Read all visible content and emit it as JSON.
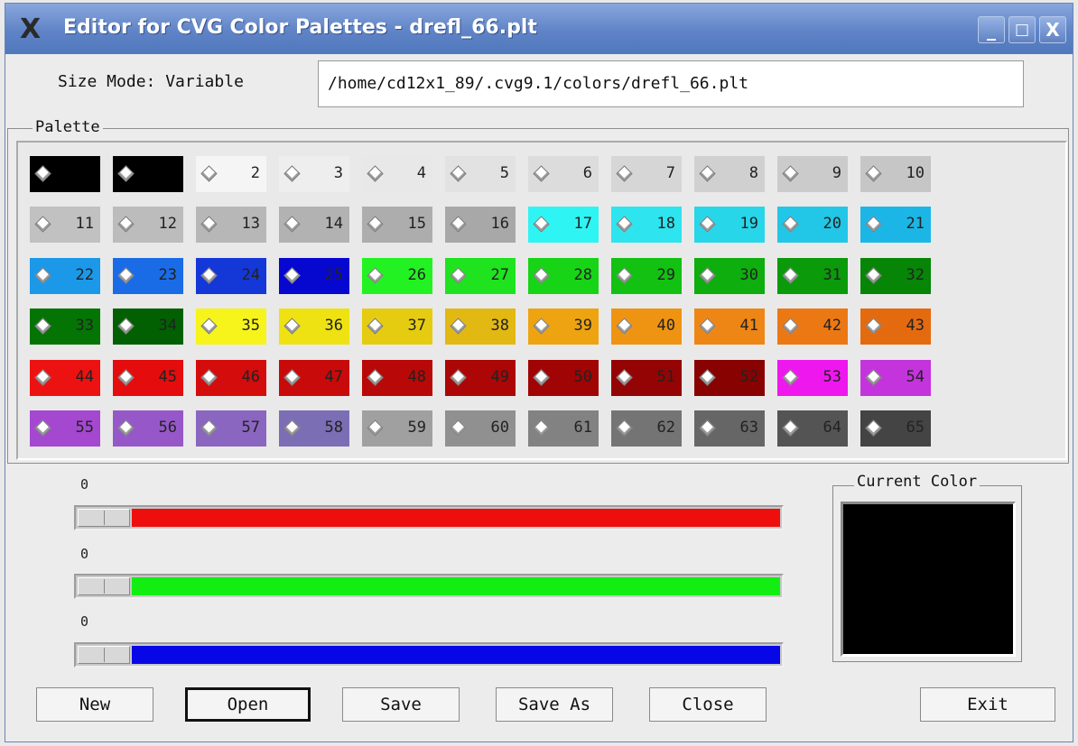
{
  "window": {
    "title": "Editor for CVG Color Palettes - drefl_66.plt",
    "app_icon": "X",
    "controls": {
      "minimize": "_",
      "maximize": "□",
      "close": "X"
    }
  },
  "header": {
    "size_mode": "Size Mode: Variable",
    "file_path": "/home/cd12x1_89/.cvg9.1/colors/drefl_66.plt"
  },
  "palette": {
    "label": "Palette",
    "swatches": [
      {
        "num": "",
        "color": "#000000"
      },
      {
        "num": "",
        "color": "#000000"
      },
      {
        "num": "2",
        "color": "#f5f5f5"
      },
      {
        "num": "3",
        "color": "#eeeeee"
      },
      {
        "num": "4",
        "color": "#e8e8e8"
      },
      {
        "num": "5",
        "color": "#e2e2e2"
      },
      {
        "num": "6",
        "color": "#dcdcdc"
      },
      {
        "num": "7",
        "color": "#d6d6d6"
      },
      {
        "num": "8",
        "color": "#d0d0d0"
      },
      {
        "num": "9",
        "color": "#cbcbcb"
      },
      {
        "num": "10",
        "color": "#c6c6c6"
      },
      {
        "num": "11",
        "color": "#c1c1c1"
      },
      {
        "num": "12",
        "color": "#bcbcbc"
      },
      {
        "num": "13",
        "color": "#b7b7b7"
      },
      {
        "num": "14",
        "color": "#b2b2b2"
      },
      {
        "num": "15",
        "color": "#adadad"
      },
      {
        "num": "16",
        "color": "#a8a8a8"
      },
      {
        "num": "17",
        "color": "#2ff4f4"
      },
      {
        "num": "18",
        "color": "#2ee4ee"
      },
      {
        "num": "19",
        "color": "#28d6ea"
      },
      {
        "num": "20",
        "color": "#22c6e6"
      },
      {
        "num": "21",
        "color": "#1cb6e6"
      },
      {
        "num": "22",
        "color": "#1c98e8"
      },
      {
        "num": "23",
        "color": "#1a6be6"
      },
      {
        "num": "24",
        "color": "#1437d8"
      },
      {
        "num": "25",
        "color": "#0608d0"
      },
      {
        "num": "26",
        "color": "#22f222"
      },
      {
        "num": "27",
        "color": "#1ee31e"
      },
      {
        "num": "28",
        "color": "#17d417"
      },
      {
        "num": "29",
        "color": "#12c112"
      },
      {
        "num": "30",
        "color": "#0eae0e"
      },
      {
        "num": "31",
        "color": "#0a9a0a"
      },
      {
        "num": "32",
        "color": "#078507"
      },
      {
        "num": "33",
        "color": "#047404"
      },
      {
        "num": "34",
        "color": "#026002"
      },
      {
        "num": "35",
        "color": "#f6f41a"
      },
      {
        "num": "36",
        "color": "#eee212"
      },
      {
        "num": "37",
        "color": "#e6cc10"
      },
      {
        "num": "38",
        "color": "#e2b812"
      },
      {
        "num": "39",
        "color": "#eea410"
      },
      {
        "num": "40",
        "color": "#ee9412"
      },
      {
        "num": "41",
        "color": "#ee8616"
      },
      {
        "num": "42",
        "color": "#ec7814"
      },
      {
        "num": "43",
        "color": "#e46a10"
      },
      {
        "num": "44",
        "color": "#ec1212"
      },
      {
        "num": "45",
        "color": "#e40c0c"
      },
      {
        "num": "46",
        "color": "#d40c0c"
      },
      {
        "num": "47",
        "color": "#c80a0a"
      },
      {
        "num": "48",
        "color": "#b80808"
      },
      {
        "num": "49",
        "color": "#ac0606"
      },
      {
        "num": "50",
        "color": "#a00404"
      },
      {
        "num": "51",
        "color": "#940404"
      },
      {
        "num": "52",
        "color": "#880202"
      },
      {
        "num": "53",
        "color": "#ee18ee"
      },
      {
        "num": "54",
        "color": "#c434dc"
      },
      {
        "num": "55",
        "color": "#a448d0"
      },
      {
        "num": "56",
        "color": "#9658c8"
      },
      {
        "num": "57",
        "color": "#8a66c0"
      },
      {
        "num": "58",
        "color": "#7c6eb4"
      },
      {
        "num": "59",
        "color": "#a0a0a0"
      },
      {
        "num": "60",
        "color": "#909090"
      },
      {
        "num": "61",
        "color": "#828282"
      },
      {
        "num": "62",
        "color": "#747474"
      },
      {
        "num": "63",
        "color": "#666666"
      },
      {
        "num": "64",
        "color": "#545454"
      },
      {
        "num": "65",
        "color": "#444444"
      }
    ]
  },
  "sliders": [
    {
      "name": "red",
      "value": "0",
      "level": 0,
      "color": "#ee0e0e"
    },
    {
      "name": "green",
      "value": "0",
      "level": 0,
      "color": "#12ee12"
    },
    {
      "name": "blue",
      "value": "0",
      "level": 0,
      "color": "#0606e6"
    }
  ],
  "current_color": {
    "label": "Current Color",
    "color": "#000000"
  },
  "buttons": {
    "new": "New",
    "open": "Open",
    "save": "Save",
    "save_as": "Save As",
    "close": "Close",
    "exit": "Exit"
  }
}
